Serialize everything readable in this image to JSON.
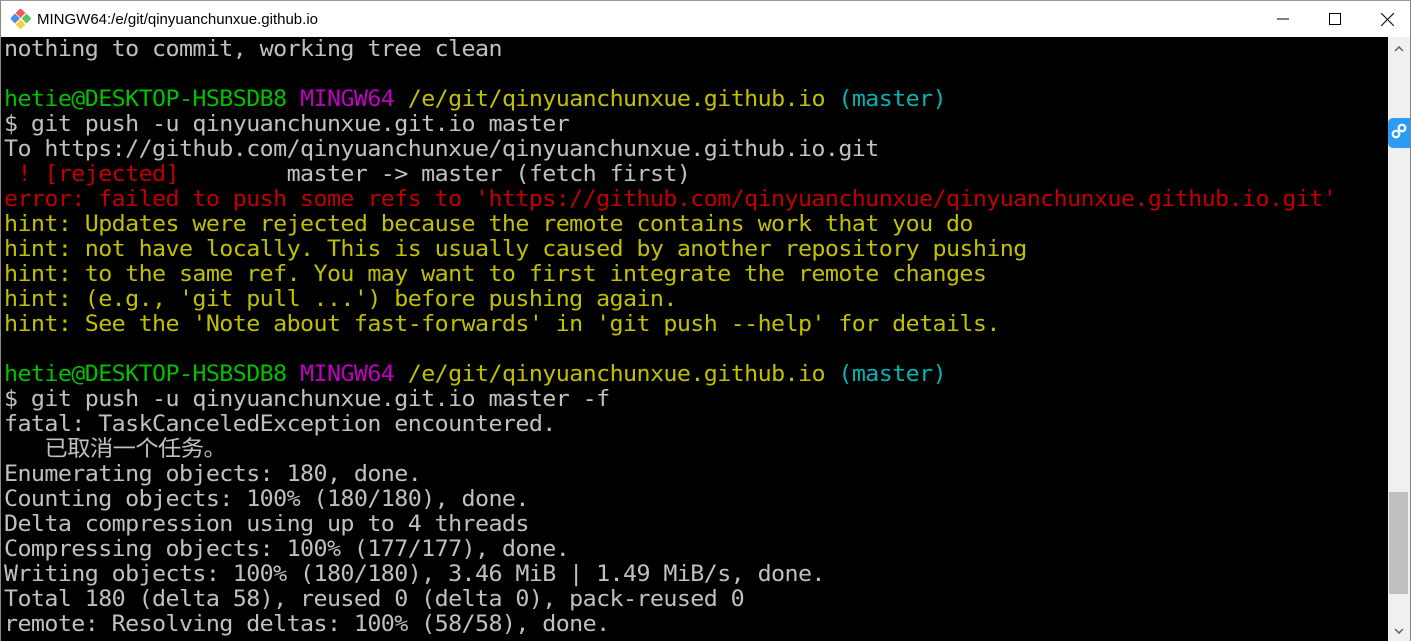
{
  "window": {
    "title": "MINGW64:/e/git/qinyuanchunxue.github.io",
    "icon": "git-bash-icon",
    "controls": {
      "minimize": "minimize-icon",
      "maximize": "maximize-icon",
      "close": "close-icon"
    }
  },
  "colors": {
    "background": "#000000",
    "default_text": "#c0c0c0",
    "user_host": "#00c000",
    "mingw": "#c000c0",
    "path": "#c0c000",
    "branch": "#00b4b4",
    "error": "#c00000",
    "hint": "#c0c000"
  },
  "terminal": {
    "lines": [
      {
        "segments": [
          {
            "text": "nothing to commit, working tree clean",
            "color": "default"
          }
        ]
      },
      {
        "segments": [
          {
            "text": "",
            "color": "default"
          }
        ]
      },
      {
        "segments": [
          {
            "text": "hetie@DESKTOP-HSBSDB8",
            "color": "green"
          },
          {
            "text": " ",
            "color": "default"
          },
          {
            "text": "MINGW64",
            "color": "magenta"
          },
          {
            "text": " ",
            "color": "default"
          },
          {
            "text": "/e/git/qinyuanchunxue.github.io",
            "color": "yellow"
          },
          {
            "text": " ",
            "color": "default"
          },
          {
            "text": "(master)",
            "color": "cyan"
          }
        ]
      },
      {
        "segments": [
          {
            "text": "$ git push -u qinyuanchunxue.git.io master",
            "color": "default"
          }
        ]
      },
      {
        "segments": [
          {
            "text": "To https://github.com/qinyuanchunxue/qinyuanchunxue.github.io.git",
            "color": "default"
          }
        ]
      },
      {
        "segments": [
          {
            "text": " ! [rejected]",
            "color": "red"
          },
          {
            "text": "        master -> master (fetch first)",
            "color": "default"
          }
        ]
      },
      {
        "segments": [
          {
            "text": "error: failed to push some refs to 'https://github.com/qinyuanchunxue/qinyuanchunxue.github.io.git'",
            "color": "red"
          }
        ]
      },
      {
        "segments": [
          {
            "text": "hint: Updates were rejected because the remote contains work that you do",
            "color": "yellow"
          }
        ]
      },
      {
        "segments": [
          {
            "text": "hint: not have locally. This is usually caused by another repository pushing",
            "color": "yellow"
          }
        ]
      },
      {
        "segments": [
          {
            "text": "hint: to the same ref. You may want to first integrate the remote changes",
            "color": "yellow"
          }
        ]
      },
      {
        "segments": [
          {
            "text": "hint: (e.g., 'git pull ...') before pushing again.",
            "color": "yellow"
          }
        ]
      },
      {
        "segments": [
          {
            "text": "hint: See the 'Note about fast-forwards' in 'git push --help' for details.",
            "color": "yellow"
          }
        ]
      },
      {
        "segments": [
          {
            "text": "",
            "color": "default"
          }
        ]
      },
      {
        "segments": [
          {
            "text": "hetie@DESKTOP-HSBSDB8",
            "color": "green"
          },
          {
            "text": " ",
            "color": "default"
          },
          {
            "text": "MINGW64",
            "color": "magenta"
          },
          {
            "text": " ",
            "color": "default"
          },
          {
            "text": "/e/git/qinyuanchunxue.github.io",
            "color": "yellow"
          },
          {
            "text": " ",
            "color": "default"
          },
          {
            "text": "(master)",
            "color": "cyan"
          }
        ]
      },
      {
        "segments": [
          {
            "text": "$ git push -u qinyuanchunxue.git.io master -f",
            "color": "default"
          }
        ]
      },
      {
        "segments": [
          {
            "text": "fatal: TaskCanceledException encountered.",
            "color": "default"
          }
        ]
      },
      {
        "segments": [
          {
            "text": "   已取消一个任务。",
            "color": "default"
          }
        ]
      },
      {
        "segments": [
          {
            "text": "Enumerating objects: 180, done.",
            "color": "default"
          }
        ]
      },
      {
        "segments": [
          {
            "text": "Counting objects: 100% (180/180), done.",
            "color": "default"
          }
        ]
      },
      {
        "segments": [
          {
            "text": "Delta compression using up to 4 threads",
            "color": "default"
          }
        ]
      },
      {
        "segments": [
          {
            "text": "Compressing objects: 100% (177/177), done.",
            "color": "default"
          }
        ]
      },
      {
        "segments": [
          {
            "text": "Writing objects: 100% (180/180), 3.46 MiB | 1.49 MiB/s, done.",
            "color": "default"
          }
        ]
      },
      {
        "segments": [
          {
            "text": "Total 180 (delta 58), reused 0 (delta 0), pack-reused 0",
            "color": "default"
          }
        ]
      },
      {
        "segments": [
          {
            "text": "remote: Resolving deltas: 100% (58/58), done.",
            "color": "default"
          }
        ]
      }
    ]
  },
  "scrollbar": {
    "up_icon": "chevron-up-icon",
    "down_icon": "chevron-down-icon",
    "position_fraction": 0.9
  },
  "floating_widget": {
    "icon": "link-icon"
  }
}
